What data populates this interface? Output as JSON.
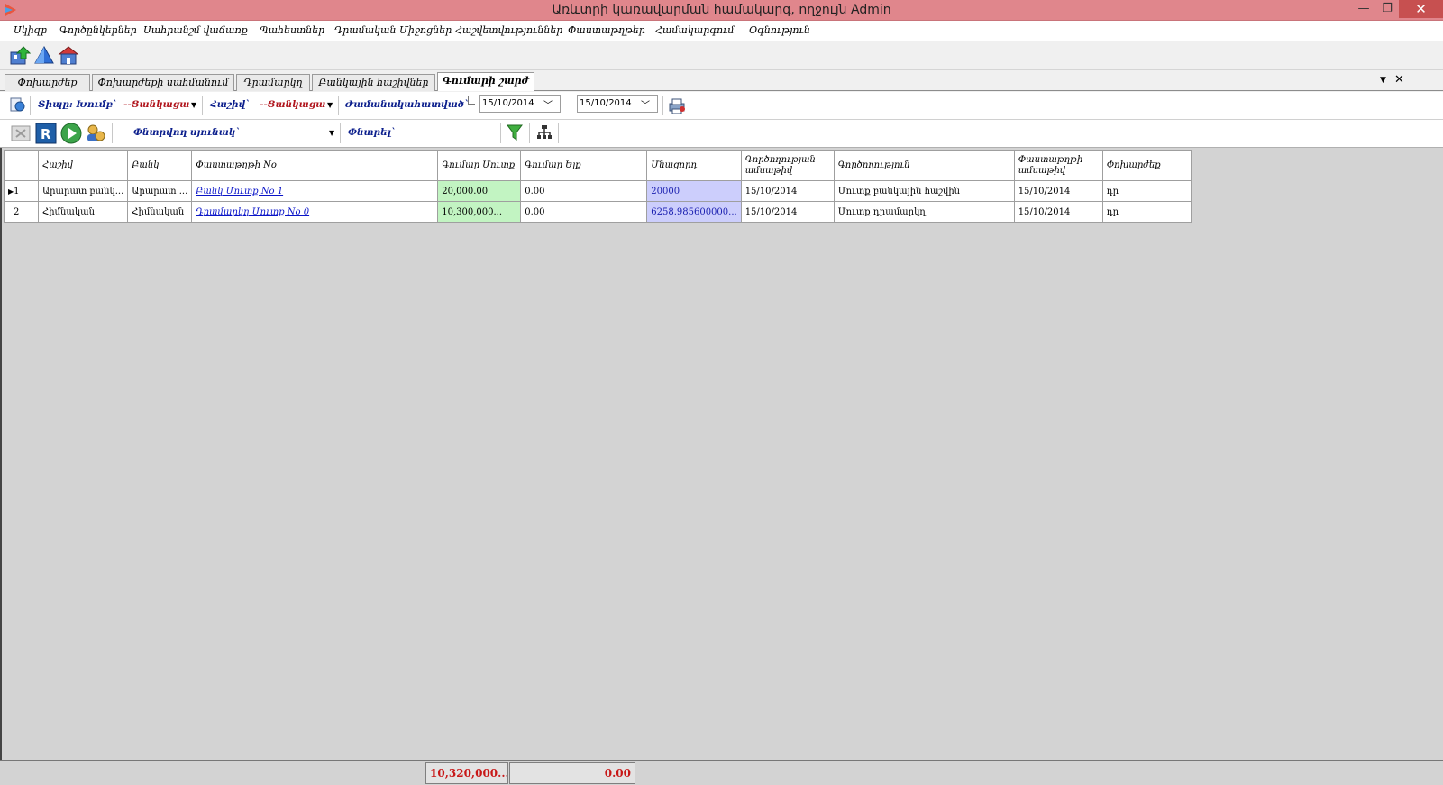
{
  "window": {
    "title": "Առևտրի կառավարման համակարգ, ողջույն Admin",
    "minimize": "—",
    "restore": "❐",
    "close": "✕"
  },
  "menu": {
    "items": [
      "Սկիզբ",
      "Գործընկերներ",
      "Սահրանշմ վաճառք",
      "Պահեստներ",
      "Դրամական Միջոցներ",
      "Հաշվետվություններ",
      "Փաստաթղթեր",
      "Համակարգում",
      "Օգնություն"
    ]
  },
  "tabs": {
    "items": [
      "Փոխարժեք",
      "Փոխարժեքի սահմանում",
      "Դրամարկղ",
      "Բանկային հաշիվներ",
      "Գումարի շարժ"
    ],
    "active_index": 4,
    "dropdown": "▼",
    "close": "✕"
  },
  "filters": {
    "type_label": "Տիպը: Խումբ`",
    "type_value": "--Ցանկացա",
    "account_label": "Հաշիվ`",
    "account_value": "--Ցանկացա",
    "period_label": "Ժամանակահատված`",
    "date_from": "15/10/2014",
    "date_to": "15/10/2014"
  },
  "search": {
    "column_label": "Փնտրվող սյունակ`",
    "search_label": "Փնտրել`",
    "value": ""
  },
  "grid": {
    "columns": [
      "",
      "Հաշիվ",
      "Բանկ",
      "Փաստաթղթի No",
      "Գումար Մուտք",
      "Գումար Ելք",
      "Մնացորդ",
      "Գործողության ամսաթիվ",
      "Գործողություն",
      "Փաստաթղթի ամսաթիվ",
      "Փոխարժեք"
    ],
    "rows": [
      {
        "num": "1",
        "current": true,
        "account": "Արարատ բանկ...",
        "bank": "Արարատ ...",
        "doc": "Բանկ Մուտք No 1",
        "in": "20,000.00",
        "out": "0.00",
        "balance": "20000",
        "op_date": "15/10/2014",
        "operation": "Մուտք բանկային հաշվին",
        "doc_date": "15/10/2014",
        "rate": "դր"
      },
      {
        "num": "2",
        "current": false,
        "account": "Հիմնական",
        "bank": "Հիմնական",
        "doc": "Դրամարկղ Մուտք No 0",
        "in": "10,300,000...",
        "out": "0.00",
        "balance": "6258.985600000...",
        "op_date": "15/10/2014",
        "operation": "Մուտք դրամարկղ",
        "doc_date": "15/10/2014",
        "rate": "դր"
      }
    ]
  },
  "totals": {
    "in": "10,320,000...",
    "out": "0.00"
  },
  "colors": {
    "titlebar": "#e0868c",
    "in_cell": "#c2f4c2",
    "balance_cell": "#cccefc",
    "link": "#0a14c8",
    "label_blue": "#0b1e8c",
    "label_red": "#b0141c"
  },
  "icons": [
    "app-icon",
    "partners-icon",
    "warehouse-icon",
    "store-icon",
    "open-doc-icon",
    "print-icon",
    "delete-icon",
    "refresh-icon",
    "play-icon",
    "users-icon",
    "filter-icon",
    "hierarchy-icon"
  ]
}
